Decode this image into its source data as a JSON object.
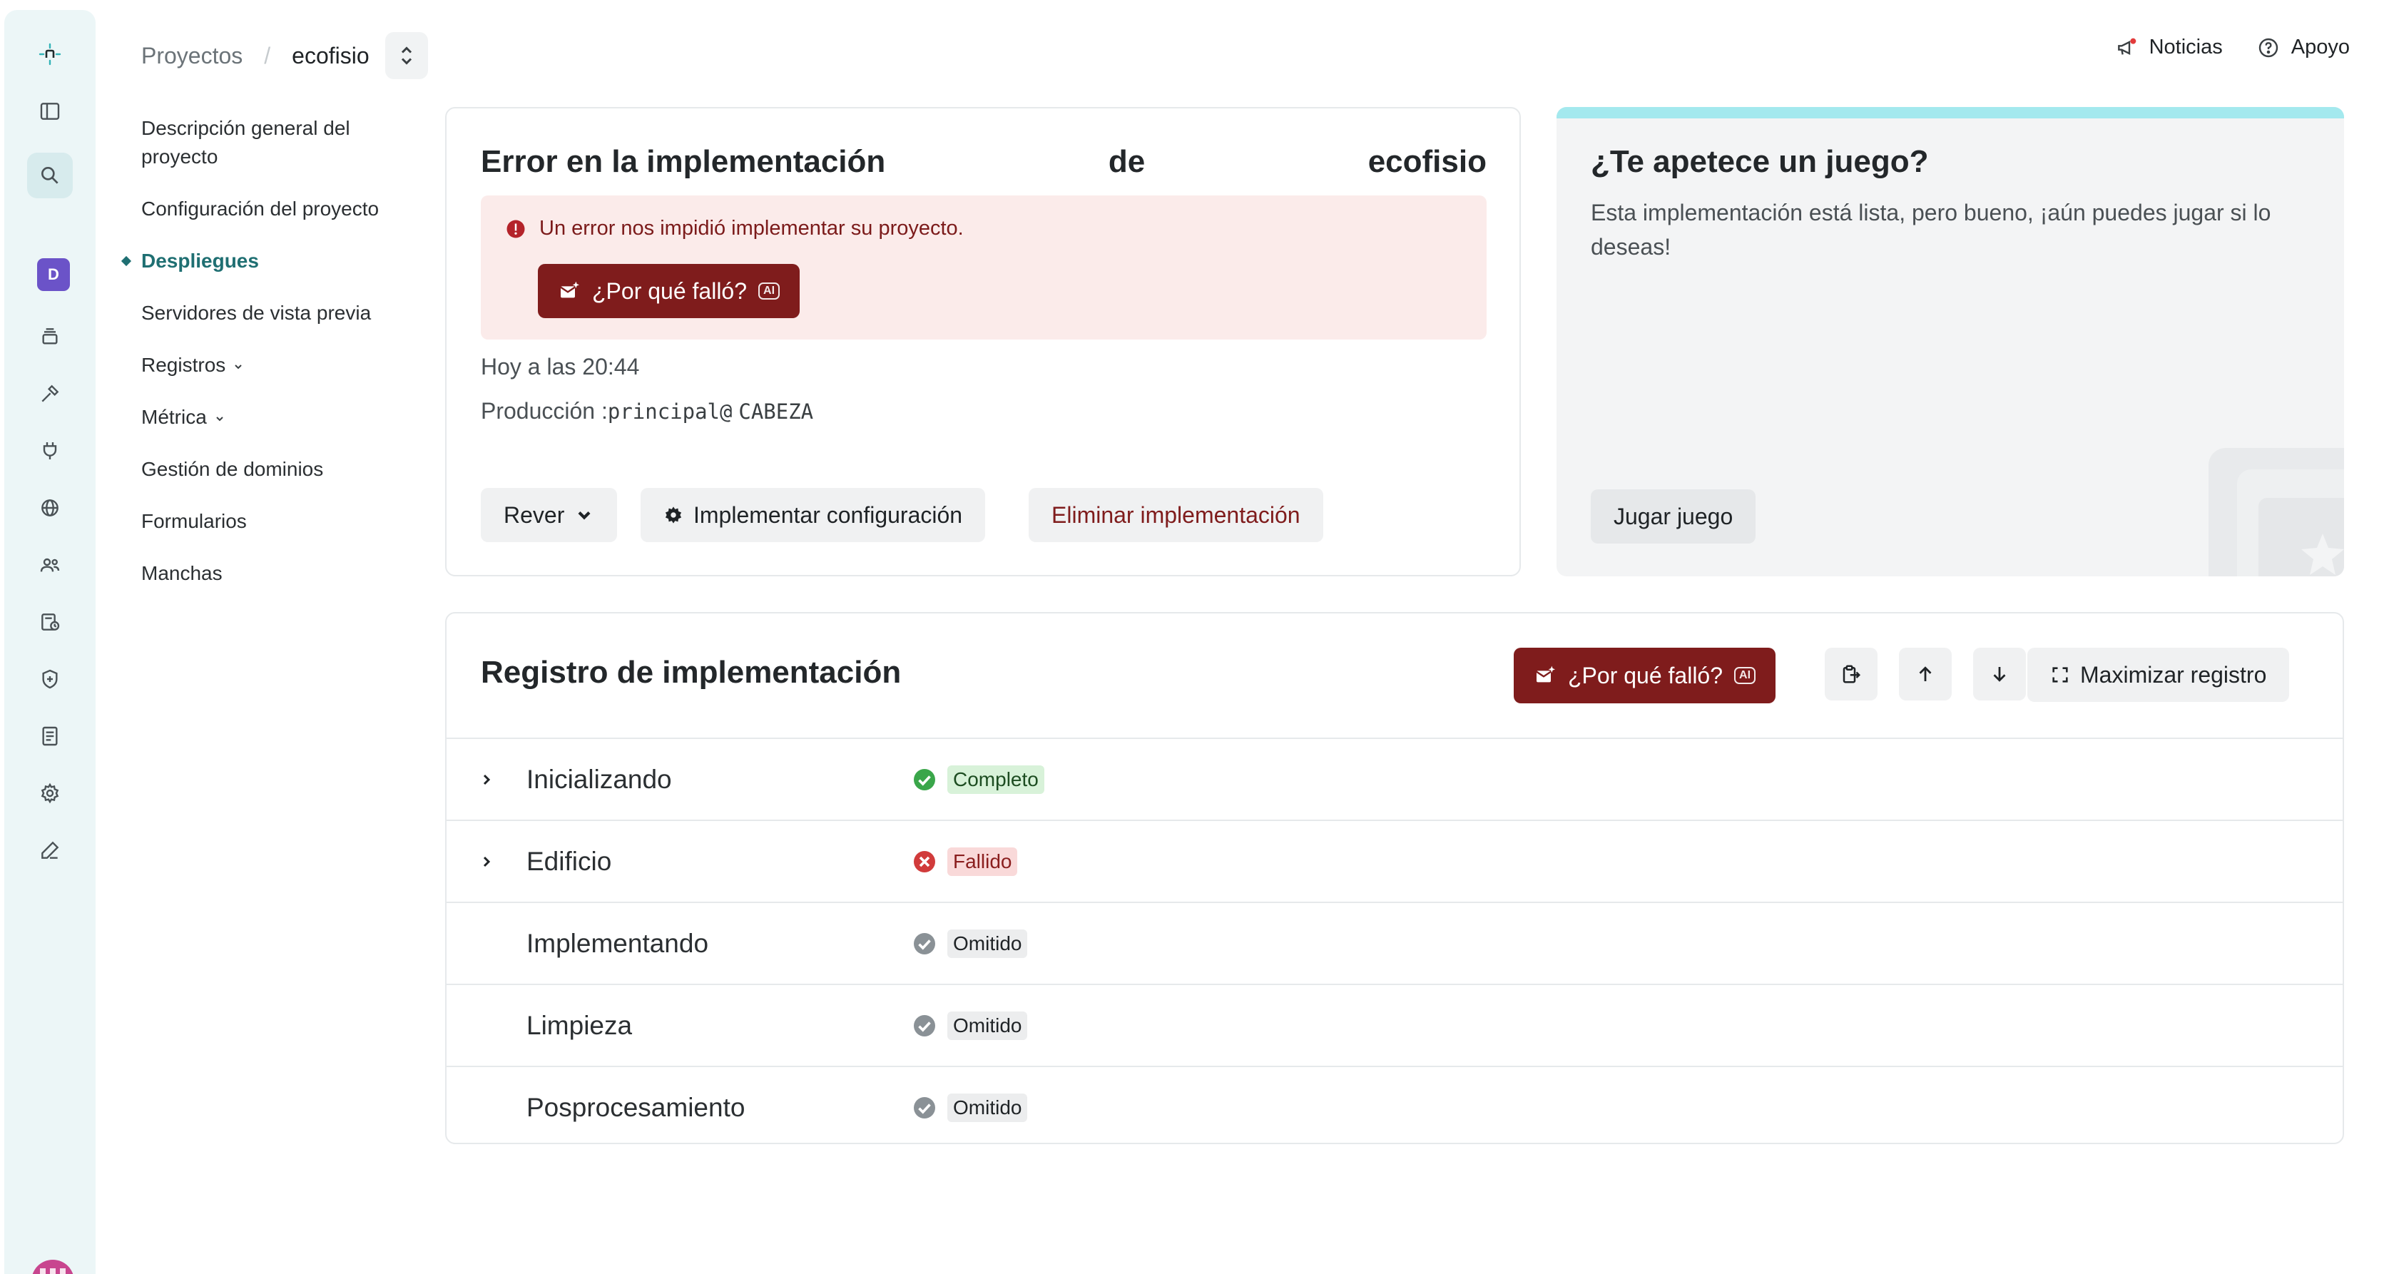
{
  "colors": {
    "accent": "#1f6f72",
    "danger": "#7f1c1c",
    "rail_bg": "#ecf6f7",
    "success": "#3aa64a",
    "fail": "#d13b3b",
    "skipped": "#8a9196"
  },
  "rail": {
    "logo_icon": "netlify-logo-icon",
    "items": [
      "sidebar-toggle-icon",
      "search-icon",
      "team-avatar",
      "layers-icon",
      "hammer-icon",
      "plug-icon",
      "globe-icon",
      "users-icon",
      "billing-icon",
      "shield-icon",
      "docs-icon",
      "gear-icon",
      "pen-icon"
    ],
    "team_initial": "D"
  },
  "header": {
    "breadcrumb_root": "Proyectos",
    "breadcrumb_separator": "/",
    "project": "ecofisio",
    "news_label": "Noticias",
    "support_label": "Apoyo"
  },
  "subnav": {
    "items": [
      {
        "label": "Descripción general del proyecto"
      },
      {
        "label": "Configuración del proyecto"
      },
      {
        "label": "Despliegues",
        "active": true
      },
      {
        "label": "Servidores de vista previa"
      },
      {
        "label": "Registros",
        "has_menu": true
      },
      {
        "label": "Métrica",
        "has_menu": true
      },
      {
        "label": "Gestión de dominios"
      },
      {
        "label": "Formularios"
      },
      {
        "label": "Manchas"
      }
    ]
  },
  "deploy": {
    "title_part1": "Error en la implementación",
    "title_part2": "de",
    "title_part3": "ecofisio",
    "alert_message": "Un error nos impidió implementar su proyecto.",
    "why_failed_label": "¿Por qué falló?",
    "ai_badge": "AI",
    "time": "Hoy a las 20:44",
    "production_prefix": "Producción :",
    "branch": "principal@",
    "head": "CABEZA",
    "revert_label": "Rever",
    "config_label": "Implementar configuración",
    "delete_label": "Eliminar implementación"
  },
  "game": {
    "title": "¿Te apetece un juego?",
    "description": "Esta implementación está lista, pero bueno, ¡aún puedes jugar si lo deseas!",
    "play_label": "Jugar juego"
  },
  "log": {
    "title": "Registro de implementación",
    "why_failed_label": "¿Por qué falló?",
    "ai_badge": "AI",
    "maximize_label": "Maximizar registro",
    "steps": [
      {
        "name": "Inicializando",
        "status": "Completo",
        "state": "ok",
        "expandable": true
      },
      {
        "name": "Edificio",
        "status": "Fallido",
        "state": "fail",
        "expandable": true
      },
      {
        "name": "Implementando",
        "status": "Omitido",
        "state": "skip",
        "expandable": false
      },
      {
        "name": "Limpieza",
        "status": "Omitido",
        "state": "skip",
        "expandable": false
      },
      {
        "name": "Posprocesamiento",
        "status": "Omitido",
        "state": "skip",
        "expandable": false
      }
    ]
  }
}
